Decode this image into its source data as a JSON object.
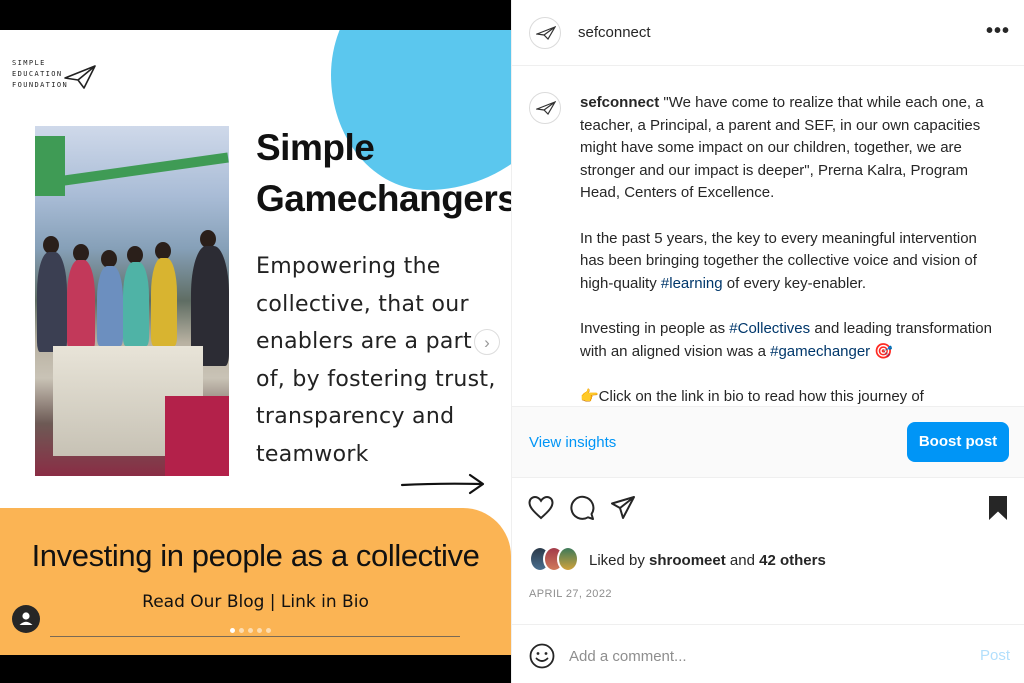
{
  "media": {
    "logo_lines": [
      "SIMPLE",
      "EDUCATION",
      "FOUNDATION"
    ],
    "title_lines": [
      "Simple",
      "Gamechangers"
    ],
    "description": "Empowering the collective, that our enablers are a part of, by fostering trust, transparency and teamwork",
    "banner_title": "Investing in people as a collective",
    "banner_subtitle": "Read Our Blog | Link in Bio",
    "slide_count": 5,
    "active_slide": 1,
    "next_glyph": "›",
    "colors": {
      "accent_blue": "#5bc7ee",
      "banner_orange": "#fbb454"
    }
  },
  "header": {
    "username": "sefconnect",
    "more_label": "•••"
  },
  "caption": {
    "username": "sefconnect",
    "para1": "\"We have come to realize that while each one, a teacher, a Principal, a parent and SEF, in our own capacities might have some impact on our children, together, we are stronger and our impact is deeper\", Prerna Kalra, Program Head, Centers of Excellence.",
    "para2_before": "In the past 5 years, the key to every meaningful intervention has been bringing together the collective voice and vision of high-quality ",
    "para2_tag": "#learning",
    "para2_after": " of every key-enabler.",
    "para3_before": "Investing in people as ",
    "para3_tag1": "#Collectives",
    "para3_middle": " and leading transformation with an aligned vision was a ",
    "para3_tag2": "#gamechanger",
    "para3_emoji": " 🎯",
    "para4": "👉Click on the link in bio to read how this journey of"
  },
  "insights": {
    "view_label": "View insights",
    "boost_label": "Boost post",
    "colors": {
      "link": "#0095f6"
    }
  },
  "actions": {
    "icons": [
      "heart-icon",
      "comment-icon",
      "share-icon",
      "bookmark-icon"
    ]
  },
  "likes": {
    "prefix": "Liked by ",
    "user": "shroomeet",
    "middle": " and ",
    "others": "42 others"
  },
  "date": "APRIL 27, 2022",
  "comment": {
    "placeholder": "Add a comment...",
    "post_label": "Post"
  }
}
